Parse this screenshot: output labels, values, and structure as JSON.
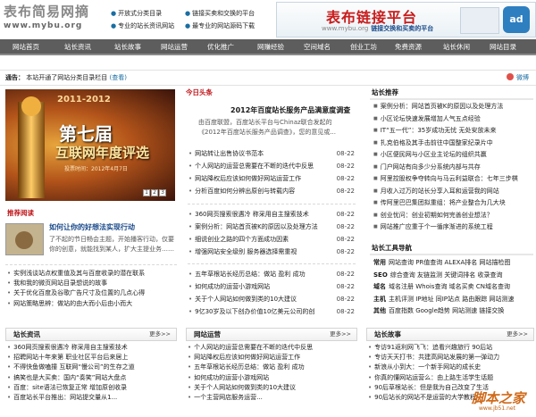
{
  "header": {
    "logo_title": "表布简易网摘",
    "logo_url": "www.mybu.org",
    "links_col1": [
      "开放式分类目录",
      "专业的站长资讯网站"
    ],
    "links_col2": [
      "链接买卖和交换的平台",
      "最专业的网站源码下载"
    ],
    "banner": {
      "title": "表布链接平台",
      "sub_url": "www.mybu.org",
      "sub_text": "链接交换和买卖的平台",
      "badge": "ad"
    }
  },
  "nav": [
    "网站首页",
    "站长资讯",
    "站长故事",
    "网站运营",
    "优化推广",
    "网赚经验",
    "空间域名",
    "创业工坊",
    "免费资源",
    "站长休闲",
    "网站目录"
  ],
  "notice": {
    "label": "通告：",
    "text": "本站开通了网站分类目录栏目",
    "more": "(查看)",
    "weibo": "微博"
  },
  "promo": {
    "year": "2011-2012",
    "line1": "第七届",
    "line2": "互联网年度评选",
    "line3": "投票时间：2012年4月7日",
    "pager": [
      "1",
      "2",
      "3"
    ]
  },
  "headline": {
    "section": "今日头条",
    "title": "2012年百度站长服务产品满意度调查",
    "summary": "由百度联盟，百度站长平台与Chinaz联合发起的《2012年百度站长服务产品调查》，您的意见或..."
  },
  "recommend": {
    "section": "推荐阅读",
    "title": "如何让你的好想法实现行动",
    "desc": "了不起的节日畅会主题，开始播客行动，仅要你的创意，就能找到某人，扩大主提业务……"
  },
  "left_list": [
    "实例浅谈站点权重值及其与百度收录的潜在联系",
    "我和我的微页网站目录想说的故事",
    "关于优化百度及谷歌广告尺寸及位置的几点心得",
    "网站策略思辨：做站的由大而小后由小而大"
  ],
  "mid_list1": [
    {
      "t": "网站转让出售协议书范本",
      "d": "08-22"
    },
    {
      "t": "个人网站的运营总需要在不断的迭代中反思",
      "d": "08-22"
    },
    {
      "t": "网站降权后应该如何做好网站运营工作",
      "d": "08-22"
    },
    {
      "t": "分析百度如何分辨出原创与转载内容",
      "d": "08-22"
    }
  ],
  "mid_list2": [
    {
      "t": "360网页搜索很遇冷 称采用自主搜索技术",
      "d": "08-22"
    },
    {
      "t": "案例分析：网站首页被K的原因以及处理方法",
      "d": "08-22"
    },
    {
      "t": "细说创业之路的四个方面成功因素",
      "d": "08-22"
    },
    {
      "t": "增强网站安全级别 服务器选择需重视",
      "d": "08-22"
    }
  ],
  "mid_list3": [
    {
      "t": "五年草根站长经历总结：做站 盈利 成功",
      "d": "08-22"
    },
    {
      "t": "如何成功的运营小游戏网站",
      "d": "08-22"
    },
    {
      "t": "关于个人网站如何做到类的10大建议",
      "d": "08-22"
    },
    {
      "t": "9亿30岁及以下创办价值10亿美元公司的创",
      "d": "08-22"
    }
  ],
  "right": {
    "section": "站长推荐",
    "items": [
      "案例分析：网站首页被K的原因以及处理方法",
      "小区论坛快速发展增加人气五点经验",
      "IT“五一代”：35岁成功无忧 无处安放未来",
      "扎克伯格及其手击前往中国整家纪录片中",
      "小区便民网与小区业主论坛的组织共赢",
      "门户网站有向多少分系统内部与共存",
      "阿里控股权争夺转向与马云利益联合：七年三步棋",
      "月收入过万的站长分享入耳和运营我的网站",
      "传阿里巴巴集团拟重组：将产业整合为几大块",
      "创业忧问：创业初期如何完善创业想法？",
      "网站推广应重于个一循序渐进的系统工程"
    ],
    "tools_title": "站长工具导航",
    "tools": [
      {
        "k": "常用",
        "v": "网站查询 PR值查询 ALEXA排名 网站描检图"
      },
      {
        "k": "SEO",
        "v": "综合查询 友链监测 关键词排名 收录查询"
      },
      {
        "k": "域名",
        "v": "域名注册 Whois查询 域名买卖 CN域名查询"
      },
      {
        "k": "主机",
        "v": "主机评测 IP地址 同IP站点 路由跟踪 网站测速"
      },
      {
        "k": "其他",
        "v": "百度指数 Google趋势 网站测速 链接交换"
      }
    ]
  },
  "bottom": {
    "box1": {
      "title": "站长资讯",
      "more": "更多>>",
      "items": [
        "360网页搜索很遇冷 称采用自主搜索技术",
        "招聘网站十年来第 职业社区平台后来居上",
        "不得快鱼做嗑撞 互联网“慢公司”的生存之道",
        "搞笑也是大买卖：国内“奏笑”网站大盘点",
        "百度：site语法已恢复正常 增加原创收录",
        "百度站长平台推出：网站提交量从1..."
      ]
    },
    "box2": {
      "title": "网站运营",
      "more": "更多>>",
      "items": [
        "个人网站的运营总需要在不断的迭代中反思",
        "网站降权后应该如何做好网站运营工作",
        "五年草根站长经历总结：做站 盈利 成功",
        "如何成功的运营小游戏网站",
        "关于个人网站如何做到类的10大建议",
        "一个主营网店服务运营..."
      ]
    },
    "box3": {
      "title": "站长故事",
      "more": "更多>>",
      "items": [
        "专访91返利网飞飞：追看兴趣旅行 90后站",
        "专访天天打书：共建高网站发展的第一弹动力",
        "新浪从小到大：一个新手网站的成长史",
        "你真的懂网站运营么：由上路生活学生话题",
        "90后草根站长：但是我为自己改变了生活",
        "90后站长的网站不是运营的大学教程"
      ]
    }
  },
  "watermark": {
    "a": "脚本之家",
    "b": "www.jb51.net"
  }
}
